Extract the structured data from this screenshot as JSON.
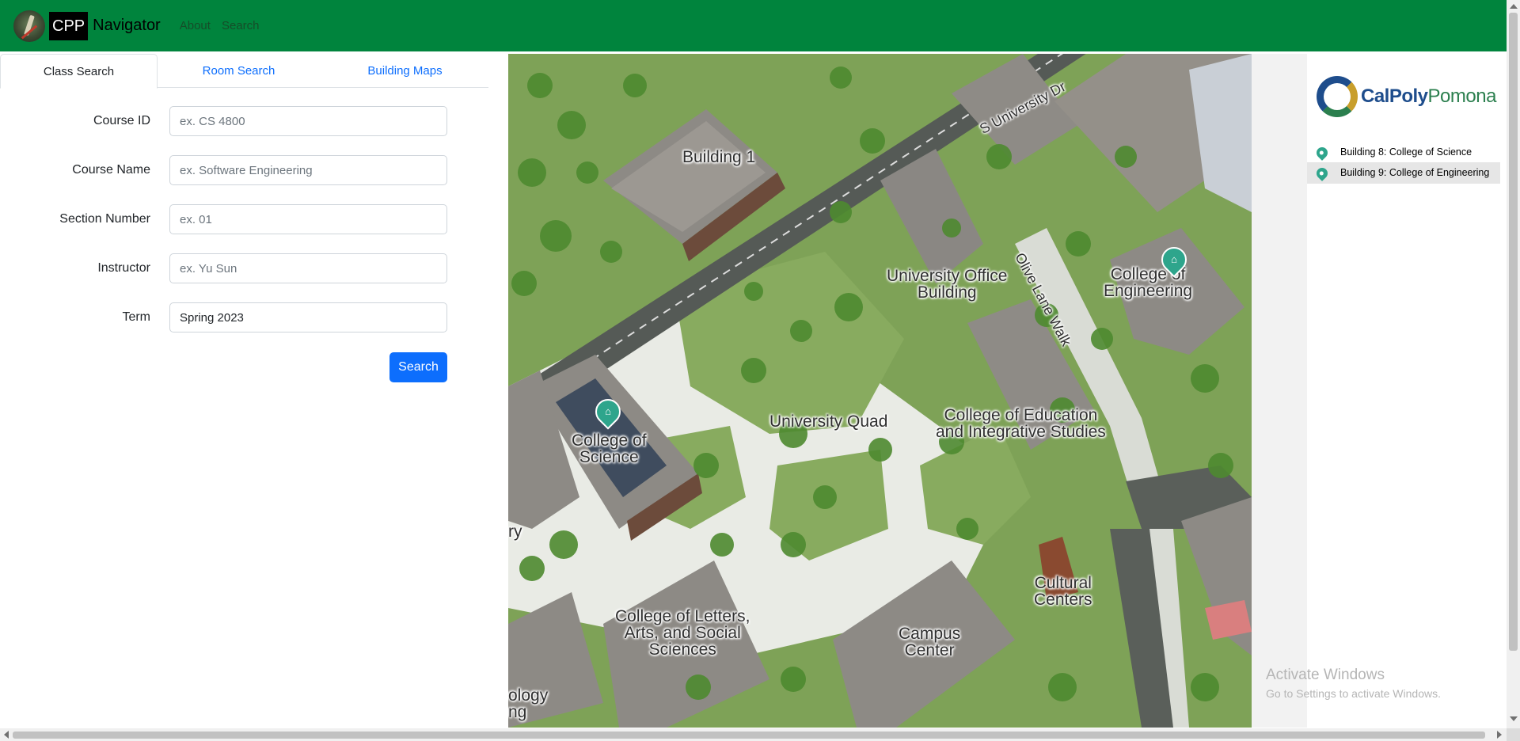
{
  "navbar": {
    "brand_box": "CPP",
    "brand_text": "Navigator",
    "links": [
      "About",
      "Search"
    ]
  },
  "tabs": [
    "Class Search",
    "Room Search",
    "Building Maps"
  ],
  "form": {
    "fields": [
      {
        "label": "Course ID",
        "placeholder": "ex. CS 4800",
        "value": ""
      },
      {
        "label": "Course Name",
        "placeholder": "ex. Software Engineering",
        "value": ""
      },
      {
        "label": "Section Number",
        "placeholder": "ex. 01",
        "value": ""
      },
      {
        "label": "Instructor",
        "placeholder": "ex. Yu Sun",
        "value": ""
      },
      {
        "label": "Term",
        "placeholder": "",
        "value": "Spring 2023"
      }
    ],
    "search_label": "Search"
  },
  "map": {
    "labels": {
      "building1": "Building 1",
      "street": "S University Dr",
      "office": "University Office\nBuilding",
      "olive": "Olive Lane Walk",
      "engineering": "College of\nEngineering",
      "science": "College of\nScience",
      "quad": "University Quad",
      "education": "College of Education\nand Integrative Studies",
      "letters": "College of Letters,\nArts, and Social\nSciences",
      "campus_center": "Campus\nCenter",
      "cultural": "Cultural\nCenters",
      "partial_left": "ry",
      "partial_bottom": "ology\nng"
    }
  },
  "sidebar": {
    "logo_text_bold": "CalPoly",
    "logo_text_normal": "Pomona",
    "buildings": [
      {
        "label": "Building 8: College of Science",
        "selected": false
      },
      {
        "label": "Building 9: College of Engineering",
        "selected": true
      }
    ]
  },
  "watermark": {
    "title": "Activate Windows",
    "subtitle": "Go to Settings to activate Windows."
  },
  "colors": {
    "navbar": "#00843d",
    "primary": "#0d6efd",
    "pin": "#2ea58c"
  },
  "icons": {
    "logo": "cpp-logo-icon",
    "pin": "map-pin-icon",
    "museum": "museum-icon"
  }
}
